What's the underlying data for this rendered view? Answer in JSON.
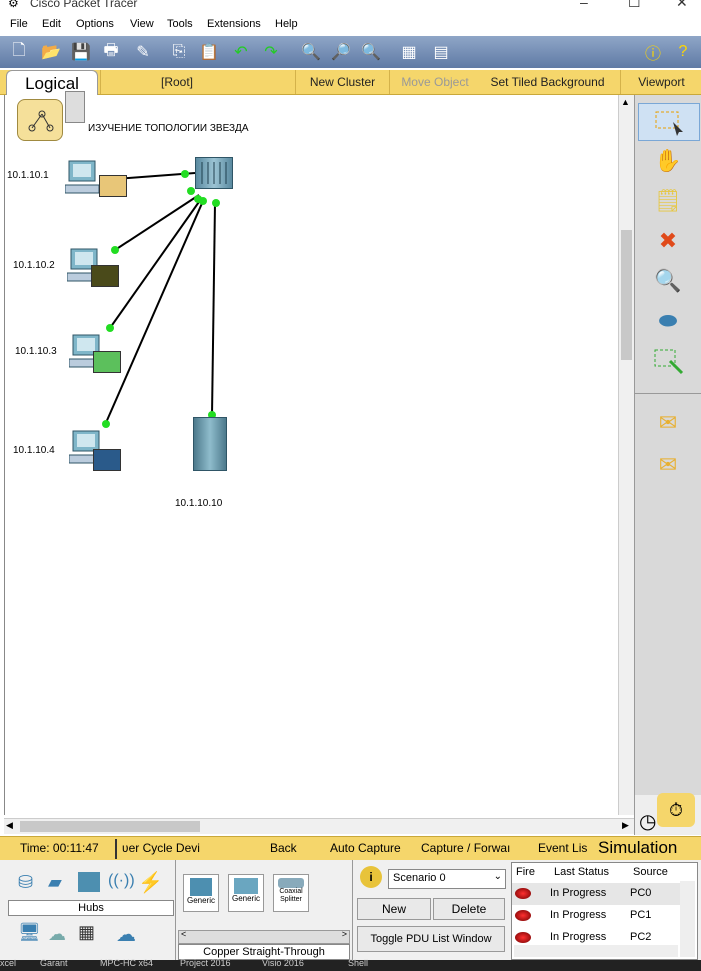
{
  "window": {
    "title": "Cisco Packet Tracer"
  },
  "menu": {
    "items": [
      "File",
      "Edit",
      "Options",
      "View",
      "Tools",
      "Extensions",
      "Help"
    ]
  },
  "workspace_bar": {
    "tab": "Logical",
    "root": "[Root]",
    "new_cluster": "New Cluster",
    "move_object": "Move Object",
    "set_bg": "Set Tiled Background",
    "viewport": "Viewport"
  },
  "canvas": {
    "note": "ИЗУЧЕНИЕ ТОПОЛОГИИ ЗВЕЗДА",
    "devices": [
      {
        "ip": "10.1.10.1",
        "envelope": "#e8c678"
      },
      {
        "ip": "10.1.10.2",
        "envelope": "#4a4a1a"
      },
      {
        "ip": "10.1.10.3",
        "envelope": "#5cc05c"
      },
      {
        "ip": "10.1.10.4",
        "envelope": "#2a5a8a"
      }
    ],
    "server_ip": "10.1.10.10"
  },
  "status_bar": {
    "time": "Time: 00:11:47",
    "power_cycle": "ʋer Cycle Devi",
    "back": "Back",
    "auto_capture": "Auto Capture",
    "capture_forward": "Capture / Forwaı",
    "event_list": "Event Lis",
    "mode": "Simulation"
  },
  "device_panel": {
    "category_label": "Hubs",
    "devices": [
      "Generic",
      "Generic",
      "Coaxial Splitter"
    ],
    "connection": "Copper Straight-Through"
  },
  "scenario": {
    "selected": "Scenario 0",
    "new_label": "New",
    "delete_label": "Delete",
    "toggle_label": "Toggle PDU List Window"
  },
  "event_table": {
    "headers": [
      "Fire",
      "Last Status",
      "Source"
    ],
    "rows": [
      {
        "status": "In Progress",
        "source": "PC0"
      },
      {
        "status": "In Progress",
        "source": "PC1"
      },
      {
        "status": "In Progress",
        "source": "PC2"
      }
    ]
  },
  "taskbar": {
    "items": [
      "xcel",
      "Garant",
      "MPC-HC x64",
      "Project 2016",
      "Visio 2016",
      "Shell"
    ]
  },
  "colors": {
    "accent_bar": "#f5d66b",
    "link": "#000000",
    "link_dot": "#22dd22"
  }
}
